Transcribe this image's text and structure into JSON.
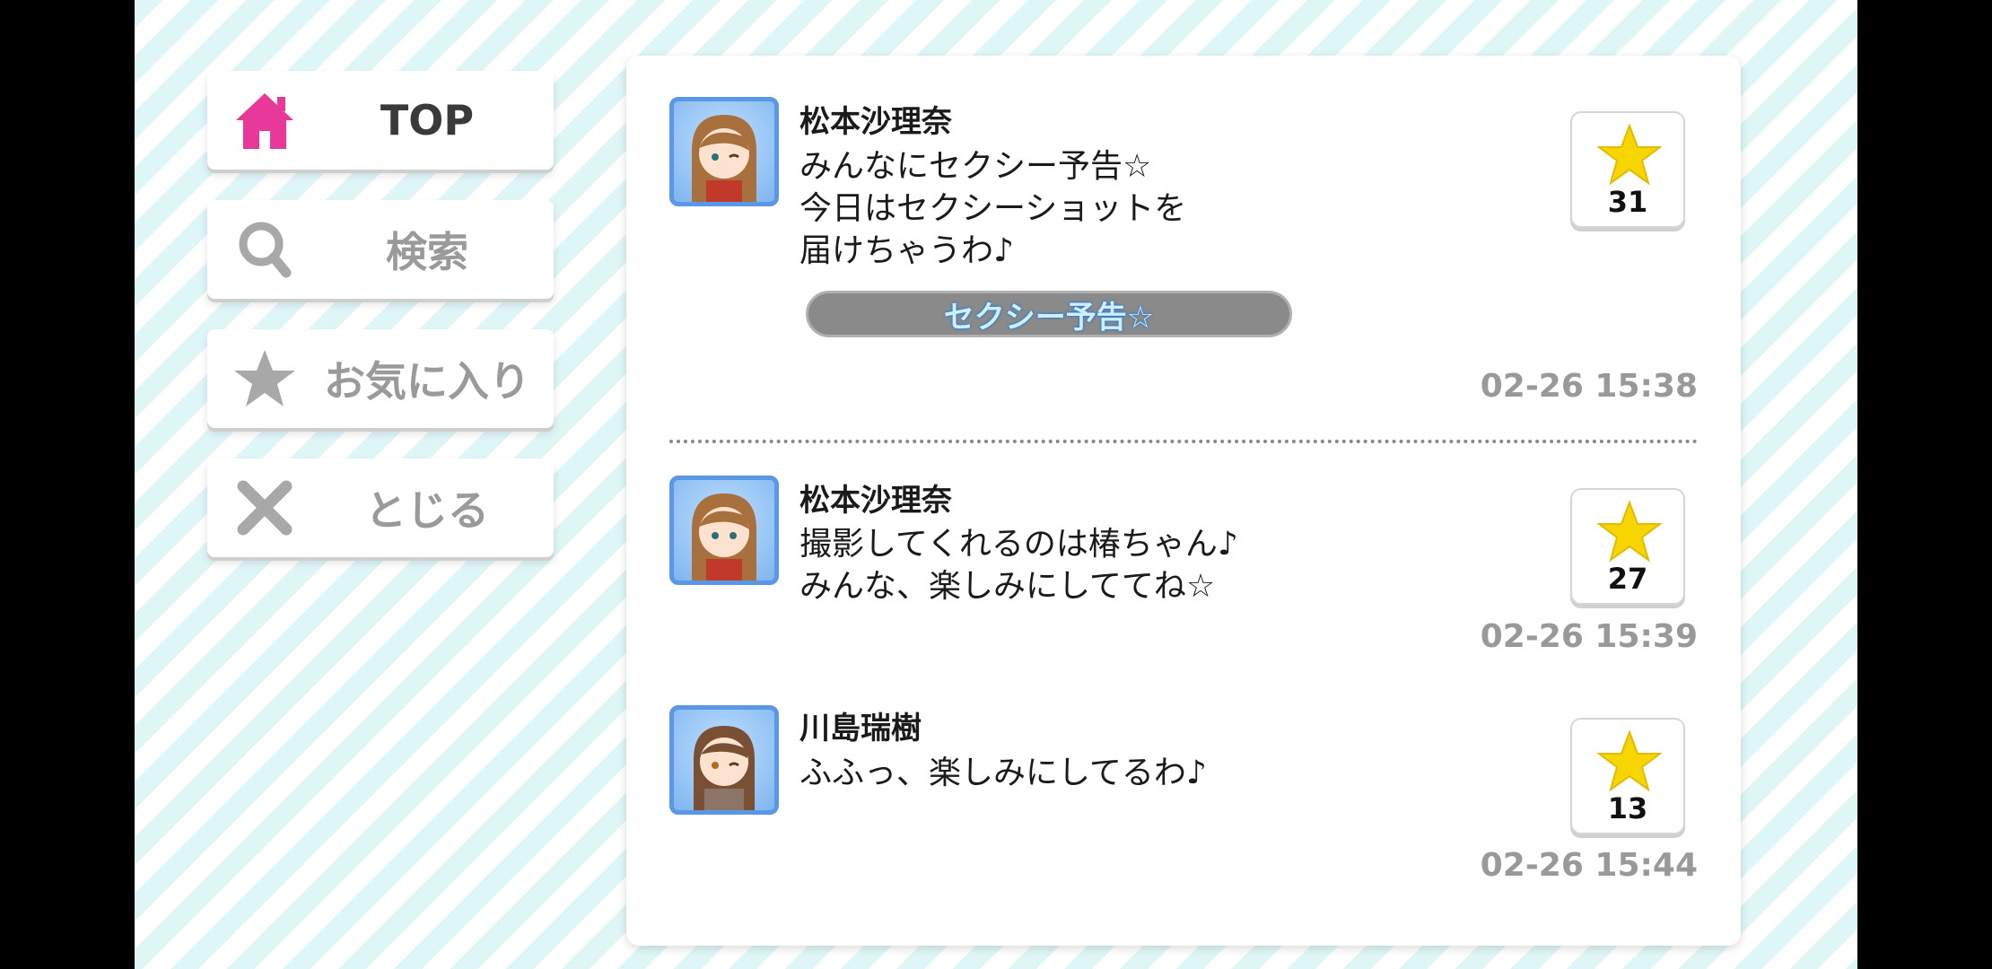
{
  "nav": {
    "top_label": "TOP",
    "search_label": "検索",
    "favorites_label": "お気に入り",
    "close_label": "とじる",
    "accent_color": "#e8399a"
  },
  "posts": [
    {
      "author": "松本沙理奈",
      "message": "みんなにセクシー予告☆\n今日はセクシーショットを\n届けちゃうわ♪",
      "tag": "セクシー予告☆",
      "likes": "31",
      "time": "02-26 15:38"
    },
    {
      "author": "松本沙理奈",
      "message": "撮影してくれるのは椿ちゃん♪\nみんな、楽しみにしててね☆",
      "likes": "27",
      "time": "02-26 15:39"
    },
    {
      "author": "川島瑞樹",
      "message": "ふふっ、楽しみにしてるわ♪",
      "likes": "13",
      "time": "02-26 15:44"
    }
  ]
}
